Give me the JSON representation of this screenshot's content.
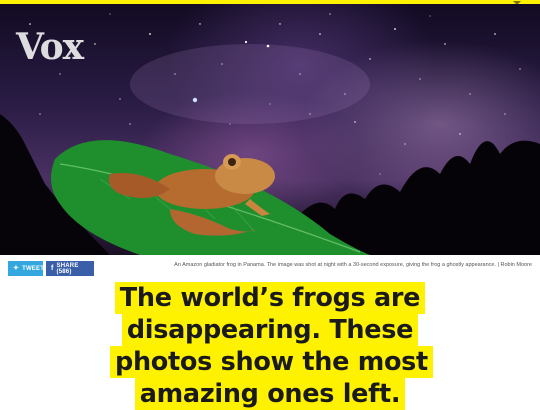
{
  "brand": {
    "logo_text": "Vox"
  },
  "hero": {
    "caption": "An Amazon gladiator frog in Panama. The image was shot at night with a 30-second exposure, giving the frog a ghostly appearance. | Robin Moore"
  },
  "share": {
    "tweet_label": "TWEET",
    "share_label": "SHARE (586)"
  },
  "article": {
    "headline": "The world’s frogs are disappearing. These photos show the most amazing ones left."
  },
  "colors": {
    "accent_yellow": "#fff200",
    "twitter_blue": "#34a7df",
    "facebook_blue": "#3a5fa8"
  },
  "icons": {
    "tweet": "twitter-bird-icon",
    "share": "facebook-icon",
    "menu": "chevron-down-icon"
  }
}
